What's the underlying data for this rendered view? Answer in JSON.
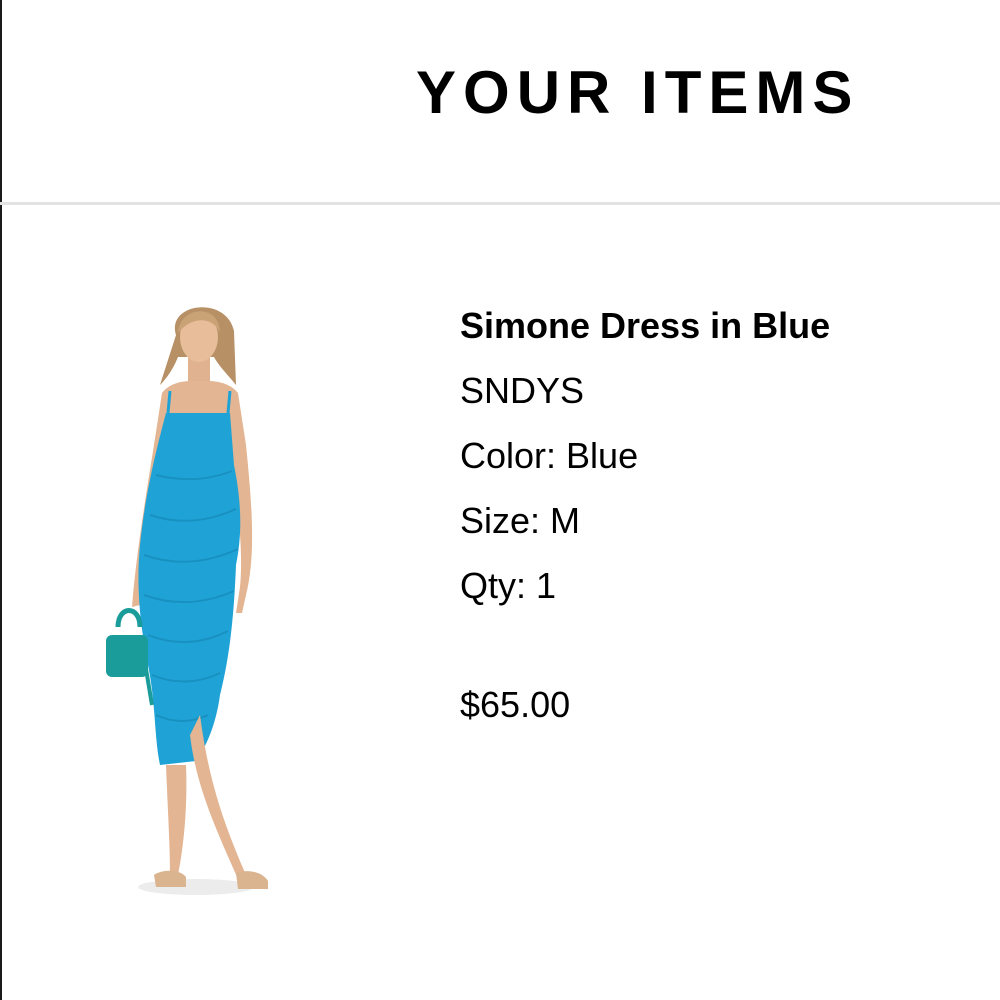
{
  "header": {
    "title": "YOUR ITEMS"
  },
  "item": {
    "name": "Simone Dress in Blue",
    "brand": "SNDYS",
    "color": "Color: Blue",
    "size": "Size: M",
    "qty": "Qty: 1",
    "price": "$65.00",
    "image_icon": "product-photo-model-in-blue-dress",
    "dress_color": "#1fa3d6",
    "bag_color": "#1a9c9a"
  }
}
